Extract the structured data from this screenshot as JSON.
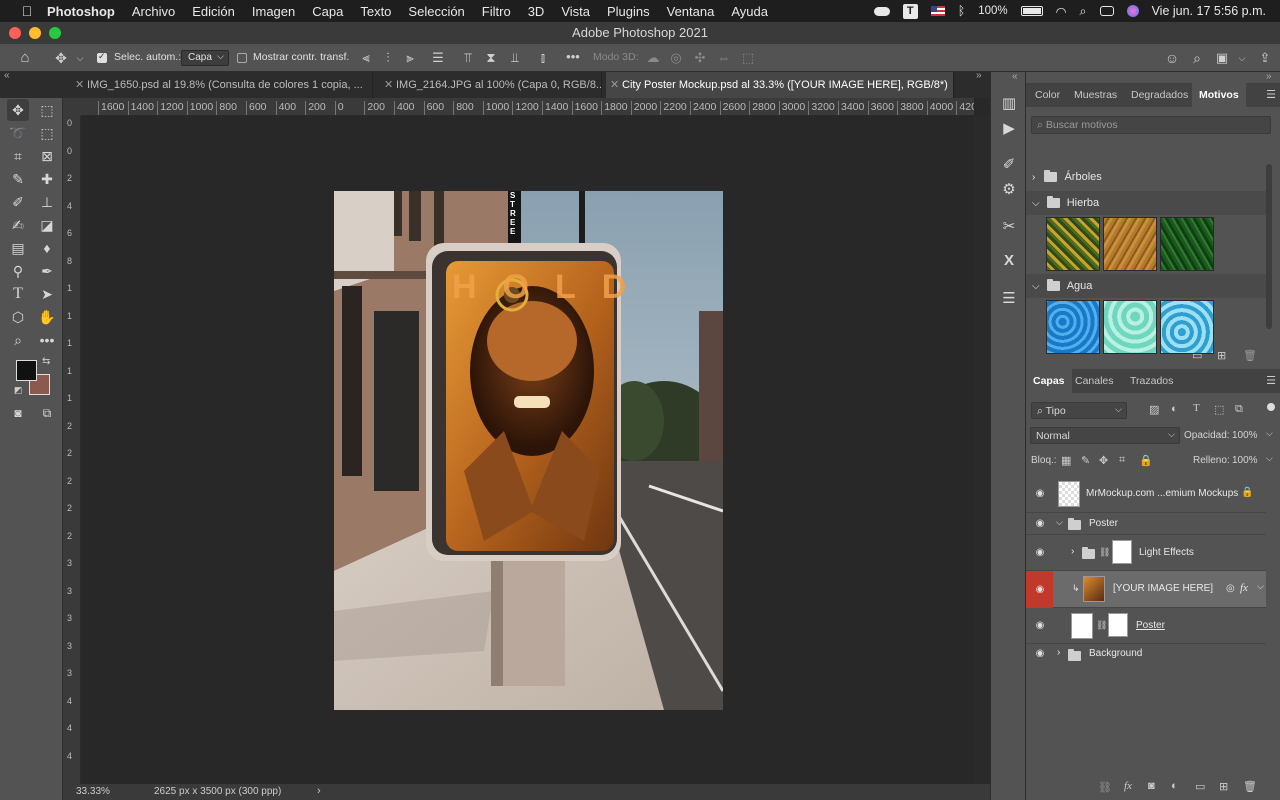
{
  "menubar": {
    "app_name": "Photoshop",
    "items": [
      "Archivo",
      "Edición",
      "Imagen",
      "Capa",
      "Texto",
      "Selección",
      "Filtro",
      "3D",
      "Vista",
      "Plugins",
      "Ventana",
      "Ayuda"
    ],
    "battery": "100%",
    "datetime": "Vie jun. 17  5:56 p.m.",
    "text_icon_letter": "T"
  },
  "window": {
    "title": "Adobe Photoshop 2021"
  },
  "options": {
    "auto_select_label": "Selec. autom.:",
    "auto_select_value": "Capa",
    "show_transform_label": "Mostrar contr. transf.",
    "mode3d_label": "Modo 3D:"
  },
  "tabs": [
    {
      "label": "IMG_1650.psd al 19.8% (Consulta de colores 1 copia, ...",
      "active": false
    },
    {
      "label": "IMG_2164.JPG al 100% (Capa 0, RGB/8...",
      "active": false
    },
    {
      "label": "City Poster Mockup.psd al 33.3% ([YOUR IMAGE HERE], RGB/8*)",
      "active": true
    }
  ],
  "ruler": {
    "h_ticks": [
      "1600",
      "1400",
      "1200",
      "1000",
      "800",
      "600",
      "400",
      "200",
      "0",
      "200",
      "400",
      "600",
      "800",
      "1000",
      "1200",
      "1400",
      "1600",
      "1800",
      "2000",
      "2200",
      "2400",
      "2600",
      "2800",
      "3000",
      "3200",
      "3400",
      "3600",
      "3800",
      "4000",
      "420"
    ],
    "v_ticks": [
      "0",
      "0",
      "2",
      "4",
      "6",
      "8",
      "1",
      "1",
      "1",
      "1",
      "1",
      "2",
      "2",
      "2",
      "2",
      "2",
      "3",
      "3",
      "3",
      "3",
      "3",
      "4",
      "4",
      "4"
    ]
  },
  "poster": {
    "text": "HOLD",
    "sign_text": "STREE"
  },
  "status": {
    "zoom": "33.33%",
    "doc_size": "2625 px x 3500 px (300 ppp)",
    "arrow": "›"
  },
  "patterns_panel": {
    "tabs": [
      "Color",
      "Muestras",
      "Degradados",
      "Motivos"
    ],
    "active_tab": "Motivos",
    "search_placeholder": "Buscar motivos",
    "groups": [
      {
        "name": "Árboles",
        "expanded": false
      },
      {
        "name": "Hierba",
        "expanded": true
      },
      {
        "name": "Agua",
        "expanded": true
      }
    ]
  },
  "layers_panel": {
    "tabs": [
      "Capas",
      "Canales",
      "Trazados"
    ],
    "active_tab": "Capas",
    "filter_label": "Tipo",
    "blend_mode": "Normal",
    "opacity_label": "Opacidad:",
    "opacity_value": "100%",
    "lock_label": "Bloq.:",
    "fill_label": "Relleno:",
    "fill_value": "100%",
    "layers": [
      {
        "name": "MrMockup.com ...emium Mockups",
        "kind": "layer",
        "locked": true
      },
      {
        "name": "Poster",
        "kind": "group-open"
      },
      {
        "name": "Light Effects",
        "kind": "group-closed"
      },
      {
        "name": "[YOUR IMAGE HERE]",
        "kind": "smart",
        "selected": true
      },
      {
        "name": "Poster",
        "kind": "layer-mask"
      },
      {
        "name": "Background",
        "kind": "group-closed"
      }
    ]
  },
  "colors": {
    "foreground": "#111111",
    "background": "#8a5a4f",
    "accent": "#c0392b"
  }
}
